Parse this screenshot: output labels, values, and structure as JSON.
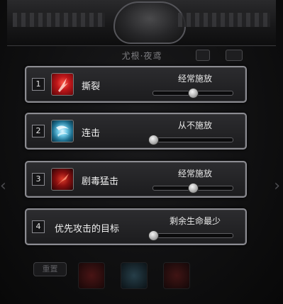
{
  "header": {
    "title": "尤根·夜鸢"
  },
  "rows": [
    {
      "index": "1",
      "skill": "撕裂",
      "icon": "claw-slash-red-icon",
      "frequency_label": "经常施放",
      "slider_level": 0.5
    },
    {
      "index": "2",
      "skill": "连击",
      "icon": "ice-swirl-blue-icon",
      "frequency_label": "从不施放",
      "slider_level": 0.0
    },
    {
      "index": "3",
      "skill": "剧毒猛击",
      "icon": "poison-strike-red-icon",
      "frequency_label": "经常施放",
      "slider_level": 0.5
    },
    {
      "index": "4",
      "skill": "优先攻击的目标",
      "icon": "",
      "frequency_label": "剩余生命最少",
      "slider_level": 0.0
    }
  ],
  "bottom": {
    "button_label": "重置",
    "slots": [
      "claw-slash-red-icon",
      "ice-swirl-blue-icon",
      "poison-strike-red-icon"
    ]
  },
  "colors": {
    "panel_border": "#8c8c92",
    "panel_bg": "#1c1c1e",
    "text": "#f0f0f0"
  }
}
